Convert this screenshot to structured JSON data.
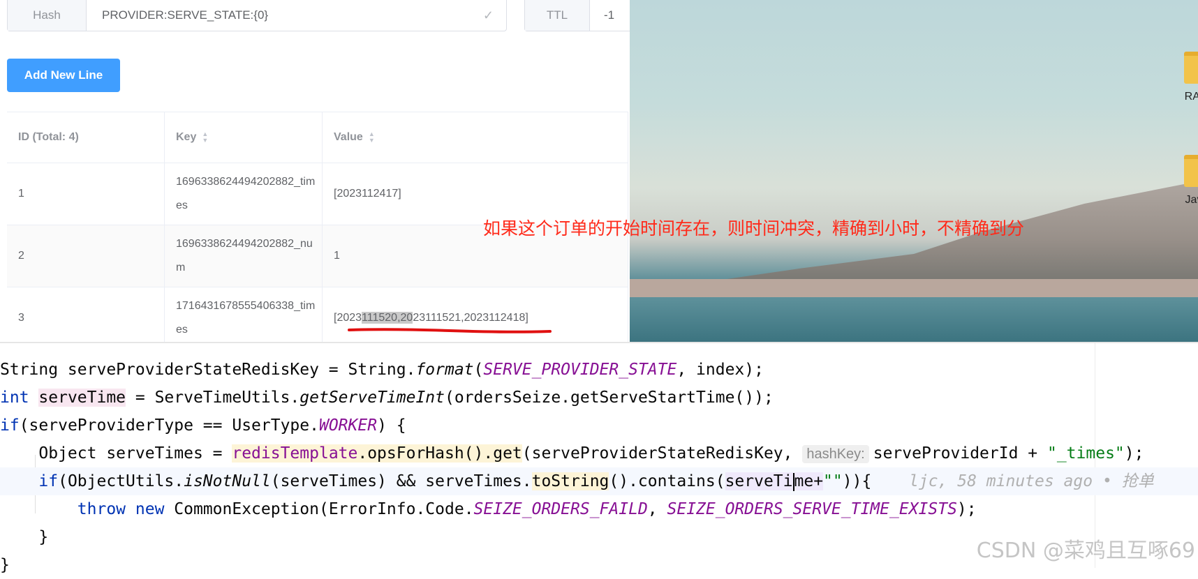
{
  "redis": {
    "hash_label": "Hash",
    "hash_value": "PROVIDER:SERVE_STATE:{0}",
    "ttl_label": "TTL",
    "ttl_value": "-1",
    "add_button": "Add New Line",
    "table": {
      "columns": [
        "ID (Total: 4)",
        "Key",
        "Value"
      ],
      "rows": [
        {
          "id": "1",
          "key": "1696338624494202882_times",
          "value": "[2023112417]"
        },
        {
          "id": "2",
          "key": "1696338624494202882_num",
          "value": "1"
        },
        {
          "id": "3",
          "key": "1716431678555406338_times",
          "value_pre": "[2023",
          "value_hl": "111520,20",
          "value_post": "23111521,2023112418]"
        }
      ]
    }
  },
  "annotation": "如果这个订单的开始时间存在，则时间冲突，精确到小时，不精确到分",
  "desktop": {
    "icons": [
      {
        "label": "RAI",
        "icon": "folder-icon"
      },
      {
        "label": "Jav",
        "icon": "folder-icon"
      }
    ]
  },
  "code": {
    "line1": {
      "a": "String serveProviderStateRedisKey = String.",
      "b": "format",
      "c": "(",
      "d": "SERVE_PROVIDER_STATE",
      "e": ", index);"
    },
    "line2": {
      "a": "int",
      "b": "serveTime",
      "c": " = ServeTimeUtils.",
      "d": "getServeTimeInt",
      "e": "(ordersSeize.getServeStartTime());"
    },
    "line3": {
      "a": "if",
      "b": "(serveProviderType == UserType.",
      "c": "WORKER",
      "d": ") {"
    },
    "line4": {
      "a": "    Object serveTimes = ",
      "b": "redisTemplate",
      "c": ".opsForHash().get",
      "d": "(serveProviderStateRedisKey, ",
      "inlay": "hashKey:",
      "e": "serveProviderId + ",
      "f": "\"_times\"",
      "g": ");"
    },
    "line5": {
      "a": "    if",
      "b": "(ObjectUtils.",
      "c": "isNotNull",
      "d": "(serveTimes) && serveTimes.",
      "e": "toString",
      "f": "().contains(",
      "g": "serveTi",
      "h": "me+",
      "i": "\"\"",
      "j": ")){",
      "blame": "ljc, 58 minutes ago • 抢单"
    },
    "line6": {
      "a": "        ",
      "b": "throw",
      "c": " ",
      "d": "new",
      "e": " CommonException(ErrorInfo.Code.",
      "f": "SEIZE_ORDERS_FAILD",
      "g": ", ",
      "h": "SEIZE_ORDERS_SERVE_TIME_EXISTS",
      "i": ");"
    },
    "line7": "    }",
    "line8": "}"
  },
  "watermark": "CSDN @菜鸡且互啄69"
}
